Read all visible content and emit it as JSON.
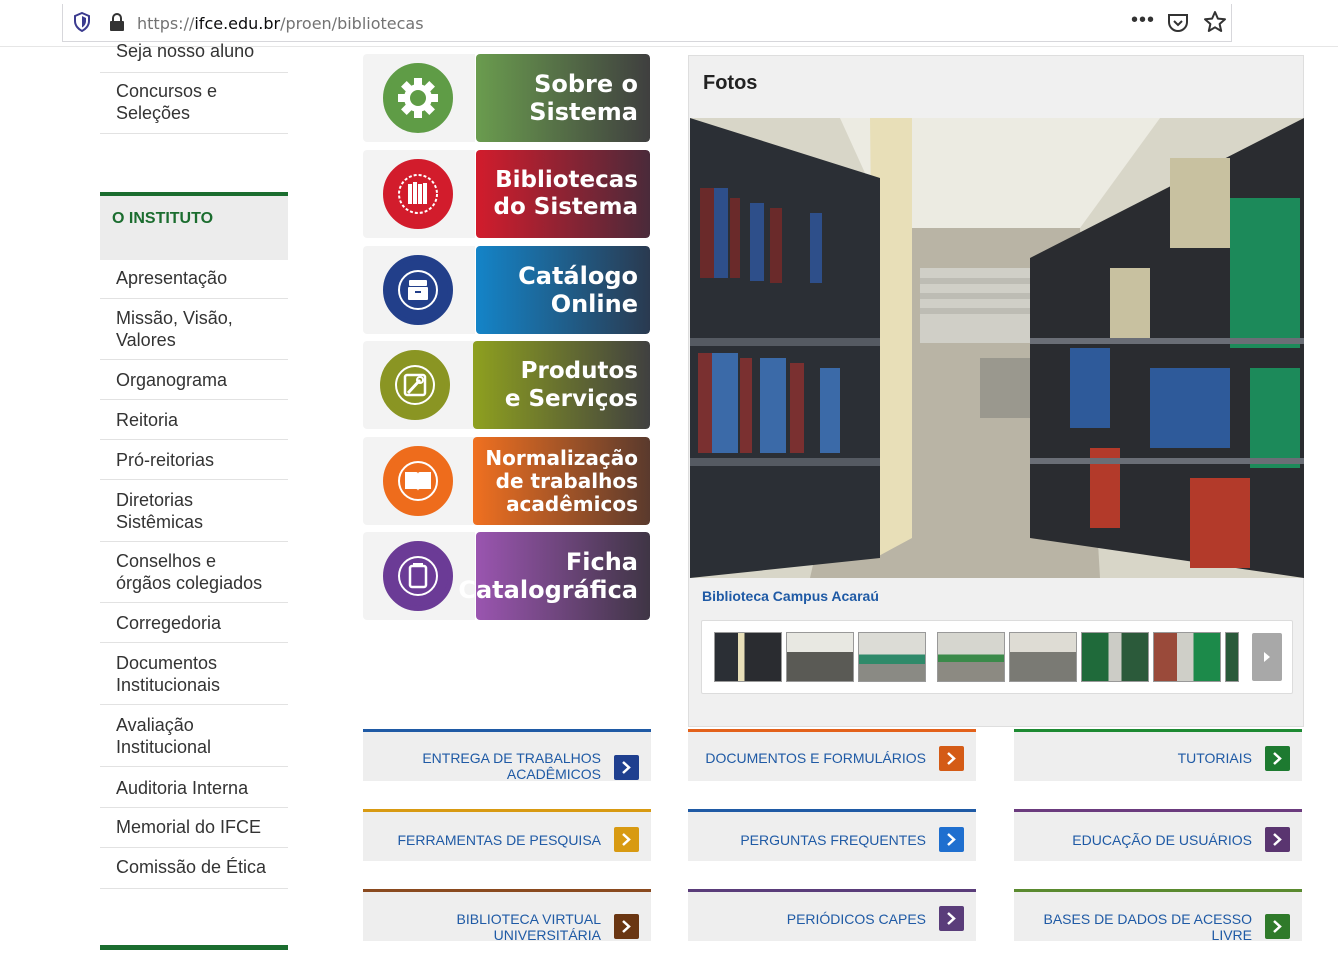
{
  "browser": {
    "url_scheme": "https://",
    "url_host": "ifce.edu.br",
    "url_path": "/proen/bibliotecas",
    "menu_dots": "•••"
  },
  "sidebar": {
    "top_items": [
      "Seja nosso aluno",
      "Concursos e\nSeleções"
    ],
    "section_title": "O INSTITUTO",
    "items": [
      "Apresentação",
      "Missão, Visão,\nValores",
      "Organograma",
      "Reitoria",
      "Pró-reitorias",
      "Diretorias\nSistêmicas",
      "Conselhos e\nórgãos colegiados",
      "Corregedoria",
      "Documentos\nInstitucionais",
      "Avaliação\nInstitucional",
      "Auditoria Interna",
      "Memorial do IFCE",
      "Comissão de Ética"
    ]
  },
  "banners": [
    {
      "label": "Sobre o\nSistema",
      "color": "#5e8f48",
      "color2": "#3f3f3f",
      "ring": "#5f9c46",
      "icon": "gear-icon"
    },
    {
      "label": "Bibliotecas\ndo Sistema",
      "color": "#d21c2c",
      "color2": "#3d2a35",
      "ring": "#d21c2c",
      "icon": "books-icon"
    },
    {
      "label": "Catálogo\nOnline",
      "color": "#1477bd",
      "color2": "#2d3a4a",
      "ring": "#223f8a",
      "icon": "catalog-icon"
    },
    {
      "label": "Produtos\ne Serviços",
      "color": "#869b1f",
      "color2": "#3d3d3d",
      "ring": "#8a9523",
      "icon": "tools-icon"
    },
    {
      "label": "Normalização\nde trabalhos\nacadêmicos",
      "color": "#ee6c1c",
      "color2": "#5a3a2d",
      "ring": "#ee6c1c",
      "icon": "book-icon"
    },
    {
      "label": "Ficha\nCatalográfica",
      "color": "#8f4fa5",
      "color2": "#3f3545",
      "ring": "#6b3b96",
      "icon": "card-icon"
    }
  ],
  "photos": {
    "title": "Fotos",
    "caption": "Biblioteca Campus Acaraú"
  },
  "links": [
    {
      "label": "ENTREGA DE TRABALHOS\nACADÊMICOS",
      "color": "#1f5aa5",
      "btn": "#1f3f8f"
    },
    {
      "label": "DOCUMENTOS E FORMULÁRIOS",
      "color": "#e3611a",
      "btn": "#d45b16"
    },
    {
      "label": "TUTORIAIS",
      "color": "#1d8a32",
      "btn": "#1d7a30"
    },
    {
      "label": "FERRAMENTAS DE PESQUISA",
      "color": "#d89a12",
      "btn": "#d89a12"
    },
    {
      "label": "PERGUNTAS FREQUENTES",
      "color": "#1f5aa5",
      "btn": "#1f6fcf"
    },
    {
      "label": "EDUCAÇÃO DE USUÁRIOS",
      "color": "#6b3b7e",
      "btn": "#5a3570"
    },
    {
      "label": "BIBLIOTECA VIRTUAL\nUNIVERSITÁRIA",
      "color": "#8a4a1f",
      "btn": "#6a3612"
    },
    {
      "label": "PERIÓDICOS CAPES",
      "color": "#5a3d7a",
      "btn": "#5a3d7a"
    },
    {
      "label": "BASES DE DADOS DE ACESSO\nLIVRE",
      "color": "#5a8a2f",
      "btn": "#2f7a2a"
    }
  ]
}
